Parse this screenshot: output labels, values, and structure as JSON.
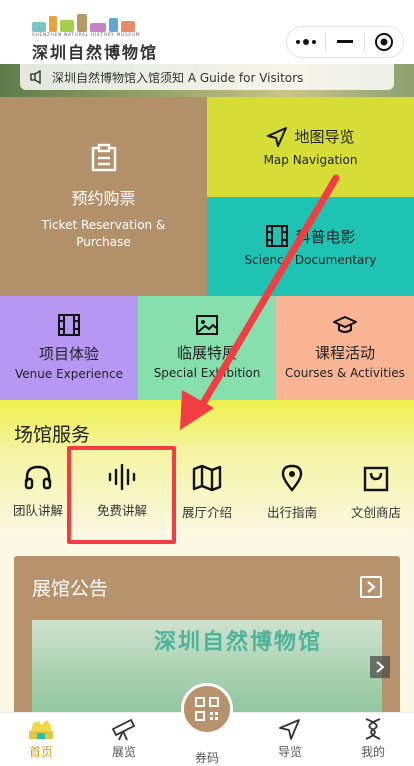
{
  "header": {
    "logo_en": "SHENZHEN NATURAL HISTORY MUSEUM",
    "logo_cn": "深圳自然博物馆",
    "capsule": {
      "more_icon": "more-dots-icon",
      "minimize_icon": "minus-icon",
      "close_icon": "target-close-icon"
    }
  },
  "banner": {
    "text": "深圳自然博物馆入馆须知 A Guide for Visitors"
  },
  "tiles": {
    "ticket": {
      "cn": "预约购票",
      "en": "Ticket Reservation & Purchase",
      "icon": "clipboard-icon"
    },
    "map": {
      "cn": "地图导览",
      "en": "Map Navigation",
      "icon": "navigation-arrow-icon"
    },
    "science": {
      "cn": "科普电影",
      "en": "Science Documentary",
      "icon": "film-icon"
    },
    "venue": {
      "cn": "项目体验",
      "en": "Venue Experience",
      "icon": "film-icon"
    },
    "special": {
      "cn": "临展特展",
      "en": "Special Exhibition",
      "icon": "image-icon"
    },
    "courses": {
      "cn": "课程活动",
      "en": "Courses & Activities",
      "icon": "graduation-cap-icon"
    }
  },
  "services": {
    "title": "场馆服务",
    "items": [
      {
        "label": "团队讲解",
        "icon": "headphones-icon"
      },
      {
        "label": "免费讲解",
        "icon": "audio-wave-icon"
      },
      {
        "label": "展厅介绍",
        "icon": "map-icon"
      },
      {
        "label": "出行指南",
        "icon": "location-pin-icon"
      },
      {
        "label": "文创商店",
        "icon": "shopping-bag-icon"
      }
    ]
  },
  "notice": {
    "title": "展馆公告",
    "image_text": "深圳自然博物馆"
  },
  "tabbar": {
    "tabs": [
      {
        "label": "首页",
        "icon": "museum-home-icon",
        "active": true
      },
      {
        "label": "展览",
        "icon": "telescope-icon",
        "active": false
      },
      {
        "label": "券码",
        "icon": "qr-code-icon",
        "active": false
      },
      {
        "label": "导览",
        "icon": "navigation-icon",
        "active": false
      },
      {
        "label": "我的",
        "icon": "dna-icon",
        "active": false
      }
    ]
  },
  "colors": {
    "accent_red": "#f23d43",
    "tan": "#b2916a",
    "yellow": "#d7dd37",
    "teal": "#1ec3b3",
    "purple": "#b698f2",
    "green": "#85e0ad",
    "peach": "#f9b494",
    "active_tab": "#c8a21a"
  }
}
